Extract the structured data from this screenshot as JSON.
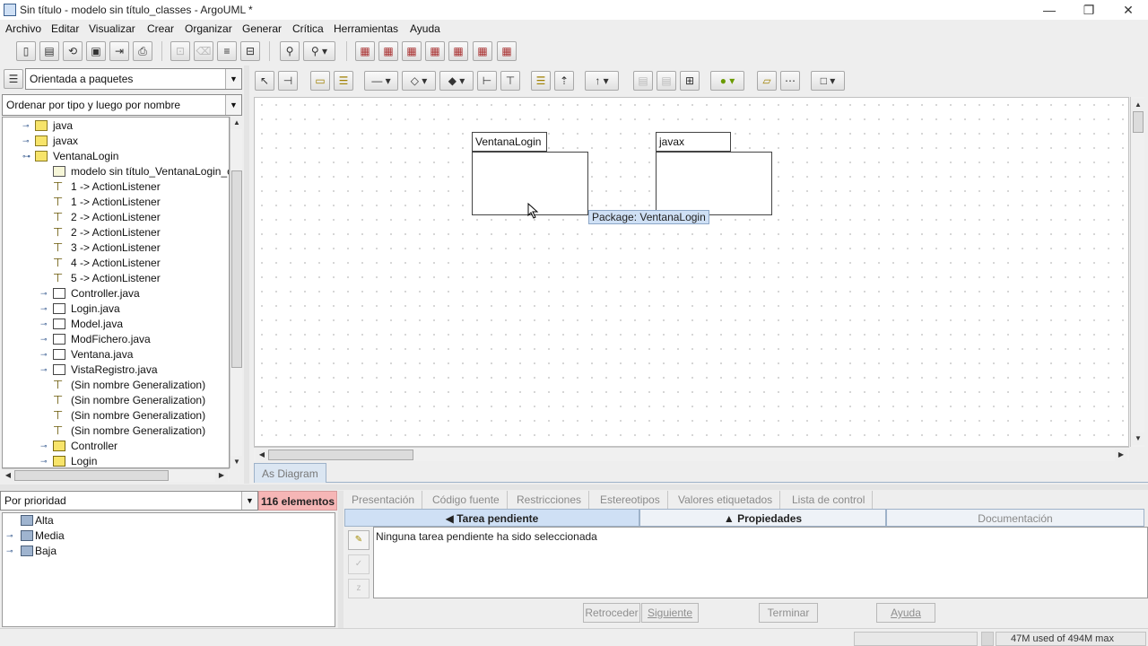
{
  "window": {
    "title": "Sin título - modelo sin título_classes - ArgoUML *",
    "minimize_glyph": "—",
    "restore_glyph": "❐",
    "close_glyph": "✕"
  },
  "menu": [
    "Archivo",
    "Editar",
    "Visualizar",
    "Crear",
    "Organizar",
    "Generar",
    "Crítica",
    "Herramientas",
    "Ayuda"
  ],
  "main_toolbar_icons": [
    "new-project-icon",
    "open-project-icon",
    "reload-icon",
    "save-project-icon",
    "save-as-icon",
    "print-icon",
    "delete-from-diagram-icon",
    "delete-icon",
    "navigate-up-icon",
    "navigate-back-icon",
    "find-icon",
    "zoom-icon",
    "class-diagram-icon",
    "usecase-diagram-icon",
    "state-diagram-icon",
    "activity-diagram-icon",
    "collaboration-diagram-icon",
    "sequence-diagram-icon",
    "deployment-diagram-icon"
  ],
  "navigator": {
    "perspective": "Orientada a paquetes",
    "ordering": "Ordenar por tipo y luego por nombre",
    "tree": [
      {
        "label": "java",
        "icon": "folder-icon",
        "depth": 1,
        "expander": "⊸"
      },
      {
        "label": "javax",
        "icon": "folder-icon",
        "depth": 1,
        "expander": "⊸"
      },
      {
        "label": "VentanaLogin",
        "icon": "folder-icon",
        "depth": 1,
        "expander": "⊶"
      },
      {
        "label": "modelo sin título_VentanaLogin_cl",
        "icon": "class-diagram-icon",
        "depth": 2,
        "expander": ""
      },
      {
        "label": "1 -> ActionListener",
        "icon": "realization-icon",
        "depth": 2,
        "expander": ""
      },
      {
        "label": "1 -> ActionListener",
        "icon": "realization-icon",
        "depth": 2,
        "expander": ""
      },
      {
        "label": "2 -> ActionListener",
        "icon": "realization-icon",
        "depth": 2,
        "expander": ""
      },
      {
        "label": "2 -> ActionListener",
        "icon": "realization-icon",
        "depth": 2,
        "expander": ""
      },
      {
        "label": "3 -> ActionListener",
        "icon": "realization-icon",
        "depth": 2,
        "expander": ""
      },
      {
        "label": "4 -> ActionListener",
        "icon": "realization-icon",
        "depth": 2,
        "expander": ""
      },
      {
        "label": "5 -> ActionListener",
        "icon": "realization-icon",
        "depth": 2,
        "expander": ""
      },
      {
        "label": "Controller.java",
        "icon": "component-icon",
        "depth": 2,
        "expander": "⊸"
      },
      {
        "label": "Login.java",
        "icon": "component-icon",
        "depth": 2,
        "expander": "⊸"
      },
      {
        "label": "Model.java",
        "icon": "component-icon",
        "depth": 2,
        "expander": "⊸"
      },
      {
        "label": "ModFichero.java",
        "icon": "component-icon",
        "depth": 2,
        "expander": "⊸"
      },
      {
        "label": "Ventana.java",
        "icon": "component-icon",
        "depth": 2,
        "expander": "⊸"
      },
      {
        "label": "VistaRegistro.java",
        "icon": "component-icon",
        "depth": 2,
        "expander": "⊸"
      },
      {
        "label": "(Sin nombre Generalization)",
        "icon": "generalization-icon",
        "depth": 2,
        "expander": ""
      },
      {
        "label": "(Sin nombre Generalization)",
        "icon": "generalization-icon",
        "depth": 2,
        "expander": ""
      },
      {
        "label": "(Sin nombre Generalization)",
        "icon": "generalization-icon",
        "depth": 2,
        "expander": ""
      },
      {
        "label": "(Sin nombre Generalization)",
        "icon": "generalization-icon",
        "depth": 2,
        "expander": ""
      },
      {
        "label": "Controller",
        "icon": "class-icon",
        "depth": 2,
        "expander": "⊸"
      },
      {
        "label": "Login",
        "icon": "class-icon",
        "depth": 2,
        "expander": "⊸"
      }
    ]
  },
  "diagram": {
    "packages": [
      {
        "name": "VentanaLogin"
      },
      {
        "name": "javax"
      }
    ],
    "tooltip": "Package: VentanaLogin",
    "tab": "As Diagram"
  },
  "todo": {
    "grouping": "Por prioridad",
    "count_badge": "116 elementos",
    "priorities": [
      "Alta",
      "Media",
      "Baja"
    ]
  },
  "details": {
    "tabs": [
      "Presentación",
      "Código fuente",
      "Restricciones",
      "Estereotipos",
      "Valores etiquetados",
      "Lista de control"
    ],
    "panel_tabs": [
      "◀ Tarea pendiente",
      "▲ Propiedades",
      "Documentación"
    ],
    "message": "Ninguna tarea pendiente ha sido seleccionada",
    "buttons": [
      "Retroceder",
      "Siguiente",
      "Terminar",
      "Ayuda"
    ]
  },
  "status": {
    "memory": "47M used of 494M max"
  },
  "colors": {
    "badge_bg": "#f6b6b6",
    "tooltip_bg": "#cfe0f5",
    "active_tab_bg": "#cfe0f5"
  }
}
